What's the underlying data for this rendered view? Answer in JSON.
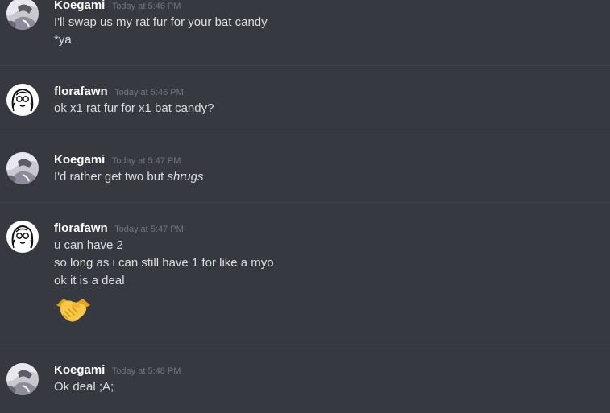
{
  "messages": [
    {
      "username": "Koegami",
      "timestamp": "Today at 5:46 PM",
      "lines": [
        "I'll swap us my rat fur for your bat candy",
        "*ya"
      ]
    },
    {
      "username": "florafawn",
      "timestamp": "Today at 5:46 PM",
      "lines": [
        "ok x1 rat fur for x1 bat candy?"
      ]
    },
    {
      "username": "Koegami",
      "timestamp": "Today at 5:47 PM",
      "line_prefix": "I'd rather get two but ",
      "line_italic": "shrugs"
    },
    {
      "username": "florafawn",
      "timestamp": "Today at 5:47 PM",
      "lines": [
        "u can have 2",
        "so long as i can still have 1 for like a myo",
        "ok it is a deal"
      ],
      "emoji": "handshake-emoji"
    },
    {
      "username": "Koegami",
      "timestamp": "Today at 5:48 PM",
      "lines": [
        "Ok deal ;A;"
      ]
    }
  ],
  "colors": {
    "background": "#36393f",
    "username": "#ffffff",
    "timestamp": "#72767d",
    "text": "#dcddde",
    "divider": "#42454a",
    "emoji": "#f7c948"
  }
}
